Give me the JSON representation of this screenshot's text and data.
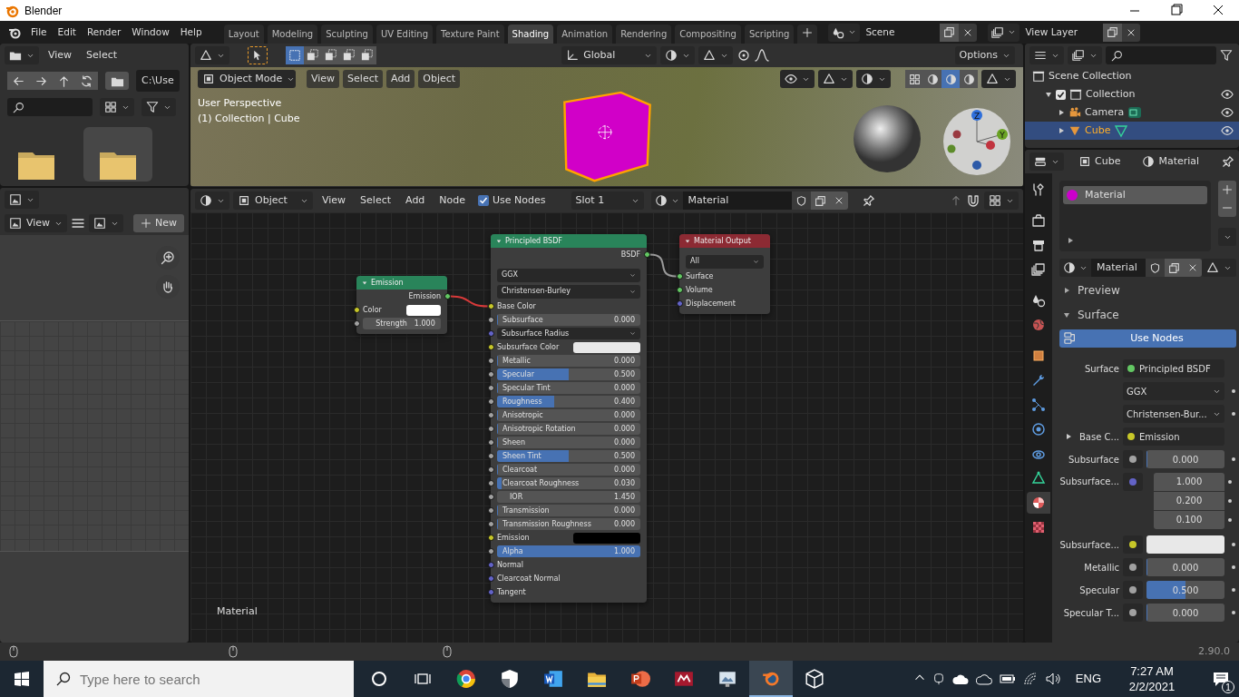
{
  "window": {
    "title": "Blender"
  },
  "menu": [
    "File",
    "Edit",
    "Render",
    "Window",
    "Help"
  ],
  "workspaces": [
    {
      "label": "Layout",
      "selected": false
    },
    {
      "label": "Modeling",
      "selected": false
    },
    {
      "label": "Sculpting",
      "selected": false
    },
    {
      "label": "UV Editing",
      "selected": false
    },
    {
      "label": "Texture Paint",
      "selected": false
    },
    {
      "label": "Shading",
      "selected": true
    },
    {
      "label": "Animation",
      "selected": false
    },
    {
      "label": "Rendering",
      "selected": false
    },
    {
      "label": "Compositing",
      "selected": false
    },
    {
      "label": "Scripting",
      "selected": false
    }
  ],
  "scene": "Scene",
  "view_layer": "View Layer",
  "file_browser": {
    "menu": [
      "View",
      "Select"
    ],
    "path": "C:\\Use"
  },
  "image_editor": {
    "view": "View",
    "new_button": "New"
  },
  "viewport": {
    "transform": "Global",
    "options": "Options",
    "mode": "Object Mode",
    "menu": [
      "View",
      "Select",
      "Add",
      "Object"
    ],
    "info": [
      "User Perspective",
      "(1) Collection | Cube"
    ],
    "gizmo_axes": [
      "Z",
      "Y"
    ]
  },
  "node_editor": {
    "shader_type": "Object",
    "menu": [
      "View",
      "Select",
      "Add",
      "Node"
    ],
    "use_nodes": {
      "label": "Use Nodes",
      "checked": true
    },
    "slot": "Slot 1",
    "material": "Material",
    "canvas_label": "Material",
    "nodes": [
      {
        "title": "Emission",
        "kind": "shader",
        "outputs": [
          {
            "label": "Emission",
            "color": "#63c763",
            "linked": true,
            "invalid_link": true
          }
        ],
        "inputs": [
          {
            "kind": "color",
            "label": "Color",
            "color": "#c7c729",
            "swatch": {
              "color": "#ffffff"
            }
          },
          {
            "kind": "number",
            "label": "Strength",
            "value": "1.000",
            "color": "#a1a1a1"
          }
        ]
      },
      {
        "title": "Principled BSDF",
        "kind": "shader",
        "settings": [
          "GGX",
          "Christensen-Burley"
        ],
        "outputs": [
          {
            "label": "BSDF",
            "color": "#63c763",
            "linked": true,
            "invalid_link": false
          }
        ],
        "inputs": [
          {
            "kind": "socket",
            "label": "Base Color",
            "color": "#c7c729",
            "linked": true
          },
          {
            "kind": "slider",
            "label": "Subsurface",
            "value": "0.000",
            "level": 0,
            "color": "#a1a1a1"
          },
          {
            "kind": "dropdown",
            "label": "Subsurface Radius",
            "color": "#6363c7"
          },
          {
            "kind": "color",
            "label": "Subsurface Color",
            "color": "#c7c729",
            "swatch": {
              "color": "#e8e8e8"
            }
          },
          {
            "kind": "slider",
            "label": "Metallic",
            "value": "0.000",
            "level": 0,
            "color": "#a1a1a1"
          },
          {
            "kind": "slider",
            "label": "Specular",
            "value": "0.500",
            "level": 0.5,
            "color": "#a1a1a1"
          },
          {
            "kind": "slider",
            "label": "Specular Tint",
            "value": "0.000",
            "level": 0,
            "color": "#a1a1a1"
          },
          {
            "kind": "slider",
            "label": "Roughness",
            "value": "0.400",
            "level": 0.4,
            "color": "#a1a1a1"
          },
          {
            "kind": "slider",
            "label": "Anisotropic",
            "value": "0.000",
            "level": 0,
            "color": "#a1a1a1"
          },
          {
            "kind": "slider",
            "label": "Anisotropic Rotation",
            "value": "0.000",
            "level": 0,
            "color": "#a1a1a1"
          },
          {
            "kind": "slider",
            "label": "Sheen",
            "value": "0.000",
            "level": 0,
            "color": "#a1a1a1"
          },
          {
            "kind": "slider",
            "label": "Sheen Tint",
            "value": "0.500",
            "level": 0.5,
            "color": "#a1a1a1"
          },
          {
            "kind": "slider",
            "label": "Clearcoat",
            "value": "0.000",
            "level": 0,
            "color": "#a1a1a1"
          },
          {
            "kind": "slider",
            "label": "Clearcoat Roughness",
            "value": "0.030",
            "level": 0.03,
            "color": "#a1a1a1"
          },
          {
            "kind": "number",
            "label": "IOR",
            "value": "1.450",
            "color": "#a1a1a1"
          },
          {
            "kind": "slider",
            "label": "Transmission",
            "value": "0.000",
            "level": 0,
            "color": "#a1a1a1"
          },
          {
            "kind": "slider",
            "label": "Transmission Roughness",
            "value": "0.000",
            "level": 0,
            "color": "#a1a1a1"
          },
          {
            "kind": "color",
            "label": "Emission",
            "color": "#c7c729",
            "swatch": {
              "color": "#000000"
            }
          },
          {
            "kind": "slider",
            "label": "Alpha",
            "value": "1.000",
            "level": 1,
            "color": "#a1a1a1"
          },
          {
            "kind": "socket",
            "label": "Normal",
            "color": "#6363c7"
          },
          {
            "kind": "socket",
            "label": "Clearcoat Normal",
            "color": "#6363c7"
          },
          {
            "kind": "socket",
            "label": "Tangent",
            "color": "#6363c7"
          }
        ]
      },
      {
        "title": "Material Output",
        "kind": "output",
        "settings": [
          "All"
        ],
        "inputs": [
          {
            "kind": "socket",
            "label": "Surface",
            "color": "#63c763",
            "linked": true
          },
          {
            "kind": "socket",
            "label": "Volume",
            "color": "#63c763"
          },
          {
            "kind": "socket",
            "label": "Displacement",
            "color": "#6363c7"
          }
        ]
      }
    ]
  },
  "outliner": {
    "items": [
      {
        "label": "Scene Collection",
        "selected": false,
        "children": [
          {
            "label": "Collection",
            "checked": true,
            "expanded": true,
            "selected": false,
            "children": [
              {
                "label": "Camera",
                "expanded": false,
                "selected": false
              },
              {
                "label": "Cube",
                "expanded": false,
                "selected": true
              }
            ]
          }
        ]
      }
    ]
  },
  "properties": {
    "tabs": [
      {
        "selected": false
      },
      {
        "selected": false
      },
      {
        "selected": false
      },
      {
        "selected": false
      },
      {
        "selected": false
      },
      {
        "selected": false
      },
      {
        "selected": false
      },
      {
        "selected": false
      },
      {
        "selected": false
      },
      {
        "selected": false
      },
      {
        "selected": false
      },
      {
        "selected": false
      },
      {
        "selected": true
      },
      {
        "selected": false
      }
    ],
    "object": "Cube",
    "context": "Material",
    "slots": [
      {
        "label": "Material",
        "color": "#cc00cc",
        "selected": true
      }
    ],
    "material": "Material",
    "panels": [
      {
        "label": "Preview",
        "expanded": false
      },
      {
        "label": "Surface",
        "expanded": true,
        "use_nodes": "Use Nodes",
        "rows": [
          {
            "kind": "link",
            "label": "Surface",
            "value": "Principled BSDF",
            "color": "#63c763"
          },
          {
            "kind": "dropdown",
            "value": "GGX"
          },
          {
            "kind": "dropdown",
            "value": "Christensen-Bur..."
          },
          {
            "kind": "link",
            "label": "Base C...",
            "value": "Emission",
            "color": "#c7c729",
            "expanded": false
          },
          {
            "kind": "value",
            "label": "Subsurface",
            "value": "0.000",
            "level": 0,
            "color": "#a1a1a1"
          },
          {
            "kind": "vector",
            "label": "Subsurface...",
            "values": [
              "1.000",
              "0.200",
              "0.100"
            ],
            "color": "#6363c7"
          },
          {
            "kind": "color",
            "label": "Subsurface...",
            "swatch": {
              "color": "#e8e8e8"
            },
            "color": "#c7c729"
          },
          {
            "kind": "value",
            "label": "Metallic",
            "value": "0.000",
            "level": 0,
            "color": "#a1a1a1"
          },
          {
            "kind": "value",
            "label": "Specular",
            "value": "0.500",
            "level": 0.5,
            "color": "#a1a1a1"
          },
          {
            "kind": "value",
            "label": "Specular T...",
            "value": "0.000",
            "level": 0,
            "color": "#a1a1a1"
          }
        ]
      }
    ]
  },
  "status_bar": {
    "version": "2.90.0"
  },
  "taskbar": {
    "search_placeholder": "Type here to search",
    "apps": [
      {
        "selected": false
      },
      {
        "selected": false
      },
      {
        "selected": false
      },
      {
        "selected": false
      },
      {
        "selected": false
      },
      {
        "selected": false
      },
      {
        "selected": false
      },
      {
        "selected": true
      },
      {
        "selected": false
      }
    ],
    "language": "ENG",
    "time": "7:27 AM",
    "date": "2/2/2021",
    "notifications": "1"
  }
}
